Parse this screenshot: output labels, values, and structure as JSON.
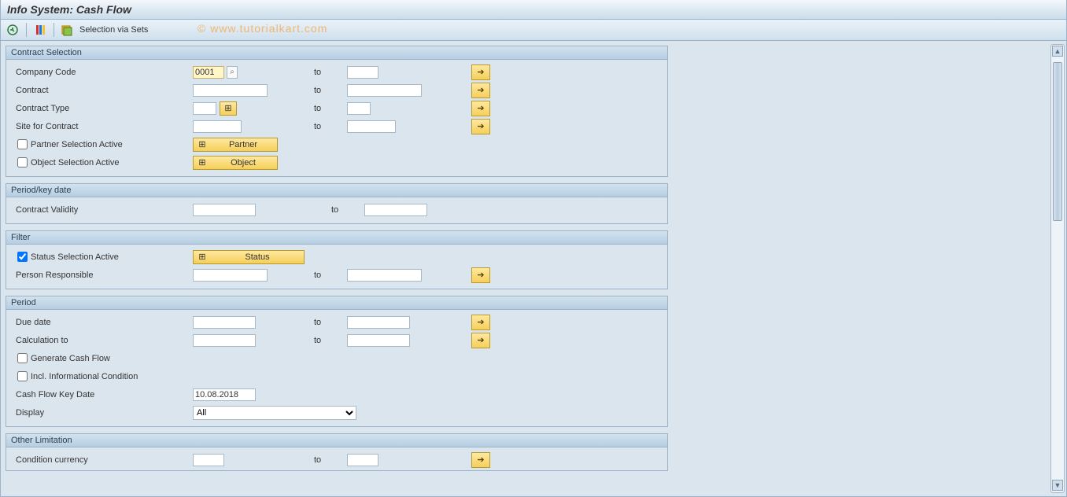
{
  "title": "Info System: Cash Flow",
  "toolbar": {
    "selection_via_sets": "Selection via Sets"
  },
  "watermark": "© www.tutorialkart.com",
  "common": {
    "to": "to"
  },
  "contract_selection": {
    "title": "Contract Selection",
    "company_code_label": "Company Code",
    "company_code_value": "0001",
    "contract_label": "Contract",
    "contract_type_label": "Contract Type",
    "site_for_contract_label": "Site for Contract",
    "partner_sel_active_label": "Partner Selection Active",
    "partner_btn": "Partner",
    "object_sel_active_label": "Object Selection Active",
    "object_btn": "Object"
  },
  "period_key_date": {
    "title": "Period/key date",
    "contract_validity_label": "Contract Validity"
  },
  "filter": {
    "title": "Filter",
    "status_sel_active_label": "Status Selection Active",
    "status_btn": "Status",
    "person_responsible_label": "Person Responsible"
  },
  "period": {
    "title": "Period",
    "due_date_label": "Due date",
    "calculation_to_label": "Calculation to",
    "generate_cf_label": "Generate Cash Flow",
    "incl_info_cond_label": "Incl. Informational Condition",
    "cf_key_date_label": "Cash Flow Key Date",
    "cf_key_date_value": "10.08.2018",
    "display_label": "Display",
    "display_value": "All"
  },
  "other_limitation": {
    "title": "Other Limitation",
    "condition_currency_label": "Condition currency"
  }
}
